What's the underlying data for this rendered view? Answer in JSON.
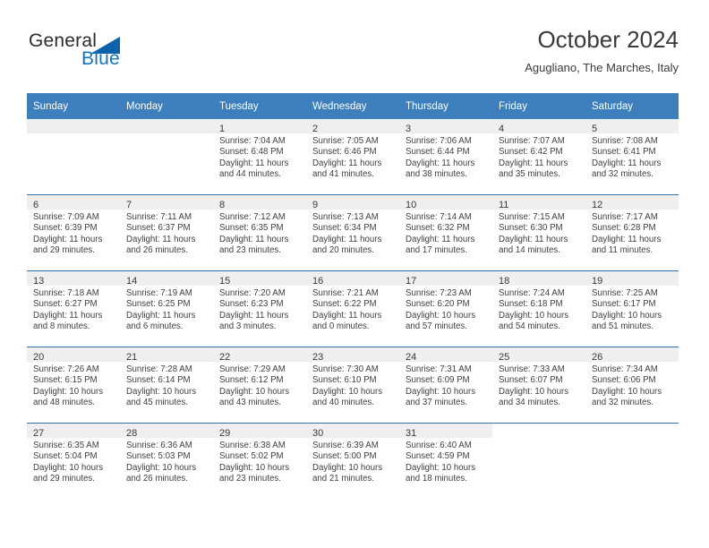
{
  "brand": {
    "name_part1": "General",
    "name_part2": "Blue",
    "accent_color": "#1275bc",
    "triangle_color": "#0b62a8"
  },
  "header": {
    "title": "October 2024",
    "subtitle": "Agugliano, The Marches, Italy"
  },
  "theme": {
    "header_row_bg": "#3d7ebd",
    "row_separator": "#2f6fad",
    "daynum_band_bg": "#efefef",
    "text_color": "#3f3f3f"
  },
  "weekday_headers": [
    "Sunday",
    "Monday",
    "Tuesday",
    "Wednesday",
    "Thursday",
    "Friday",
    "Saturday"
  ],
  "labels": {
    "sunrise_prefix": "Sunrise:",
    "sunset_prefix": "Sunset:",
    "daylight_prefix": "Daylight:"
  },
  "weeks": [
    [
      {
        "day": "",
        "sunrise": "",
        "sunset": "",
        "daylight_line1": "",
        "daylight_line2": ""
      },
      {
        "day": "",
        "sunrise": "",
        "sunset": "",
        "daylight_line1": "",
        "daylight_line2": ""
      },
      {
        "day": "1",
        "sunrise": "Sunrise: 7:04 AM",
        "sunset": "Sunset: 6:48 PM",
        "daylight_line1": "Daylight: 11 hours",
        "daylight_line2": "and 44 minutes."
      },
      {
        "day": "2",
        "sunrise": "Sunrise: 7:05 AM",
        "sunset": "Sunset: 6:46 PM",
        "daylight_line1": "Daylight: 11 hours",
        "daylight_line2": "and 41 minutes."
      },
      {
        "day": "3",
        "sunrise": "Sunrise: 7:06 AM",
        "sunset": "Sunset: 6:44 PM",
        "daylight_line1": "Daylight: 11 hours",
        "daylight_line2": "and 38 minutes."
      },
      {
        "day": "4",
        "sunrise": "Sunrise: 7:07 AM",
        "sunset": "Sunset: 6:42 PM",
        "daylight_line1": "Daylight: 11 hours",
        "daylight_line2": "and 35 minutes."
      },
      {
        "day": "5",
        "sunrise": "Sunrise: 7:08 AM",
        "sunset": "Sunset: 6:41 PM",
        "daylight_line1": "Daylight: 11 hours",
        "daylight_line2": "and 32 minutes."
      }
    ],
    [
      {
        "day": "6",
        "sunrise": "Sunrise: 7:09 AM",
        "sunset": "Sunset: 6:39 PM",
        "daylight_line1": "Daylight: 11 hours",
        "daylight_line2": "and 29 minutes."
      },
      {
        "day": "7",
        "sunrise": "Sunrise: 7:11 AM",
        "sunset": "Sunset: 6:37 PM",
        "daylight_line1": "Daylight: 11 hours",
        "daylight_line2": "and 26 minutes."
      },
      {
        "day": "8",
        "sunrise": "Sunrise: 7:12 AM",
        "sunset": "Sunset: 6:35 PM",
        "daylight_line1": "Daylight: 11 hours",
        "daylight_line2": "and 23 minutes."
      },
      {
        "day": "9",
        "sunrise": "Sunrise: 7:13 AM",
        "sunset": "Sunset: 6:34 PM",
        "daylight_line1": "Daylight: 11 hours",
        "daylight_line2": "and 20 minutes."
      },
      {
        "day": "10",
        "sunrise": "Sunrise: 7:14 AM",
        "sunset": "Sunset: 6:32 PM",
        "daylight_line1": "Daylight: 11 hours",
        "daylight_line2": "and 17 minutes."
      },
      {
        "day": "11",
        "sunrise": "Sunrise: 7:15 AM",
        "sunset": "Sunset: 6:30 PM",
        "daylight_line1": "Daylight: 11 hours",
        "daylight_line2": "and 14 minutes."
      },
      {
        "day": "12",
        "sunrise": "Sunrise: 7:17 AM",
        "sunset": "Sunset: 6:28 PM",
        "daylight_line1": "Daylight: 11 hours",
        "daylight_line2": "and 11 minutes."
      }
    ],
    [
      {
        "day": "13",
        "sunrise": "Sunrise: 7:18 AM",
        "sunset": "Sunset: 6:27 PM",
        "daylight_line1": "Daylight: 11 hours",
        "daylight_line2": "and 8 minutes."
      },
      {
        "day": "14",
        "sunrise": "Sunrise: 7:19 AM",
        "sunset": "Sunset: 6:25 PM",
        "daylight_line1": "Daylight: 11 hours",
        "daylight_line2": "and 6 minutes."
      },
      {
        "day": "15",
        "sunrise": "Sunrise: 7:20 AM",
        "sunset": "Sunset: 6:23 PM",
        "daylight_line1": "Daylight: 11 hours",
        "daylight_line2": "and 3 minutes."
      },
      {
        "day": "16",
        "sunrise": "Sunrise: 7:21 AM",
        "sunset": "Sunset: 6:22 PM",
        "daylight_line1": "Daylight: 11 hours",
        "daylight_line2": "and 0 minutes."
      },
      {
        "day": "17",
        "sunrise": "Sunrise: 7:23 AM",
        "sunset": "Sunset: 6:20 PM",
        "daylight_line1": "Daylight: 10 hours",
        "daylight_line2": "and 57 minutes."
      },
      {
        "day": "18",
        "sunrise": "Sunrise: 7:24 AM",
        "sunset": "Sunset: 6:18 PM",
        "daylight_line1": "Daylight: 10 hours",
        "daylight_line2": "and 54 minutes."
      },
      {
        "day": "19",
        "sunrise": "Sunrise: 7:25 AM",
        "sunset": "Sunset: 6:17 PM",
        "daylight_line1": "Daylight: 10 hours",
        "daylight_line2": "and 51 minutes."
      }
    ],
    [
      {
        "day": "20",
        "sunrise": "Sunrise: 7:26 AM",
        "sunset": "Sunset: 6:15 PM",
        "daylight_line1": "Daylight: 10 hours",
        "daylight_line2": "and 48 minutes."
      },
      {
        "day": "21",
        "sunrise": "Sunrise: 7:28 AM",
        "sunset": "Sunset: 6:14 PM",
        "daylight_line1": "Daylight: 10 hours",
        "daylight_line2": "and 45 minutes."
      },
      {
        "day": "22",
        "sunrise": "Sunrise: 7:29 AM",
        "sunset": "Sunset: 6:12 PM",
        "daylight_line1": "Daylight: 10 hours",
        "daylight_line2": "and 43 minutes."
      },
      {
        "day": "23",
        "sunrise": "Sunrise: 7:30 AM",
        "sunset": "Sunset: 6:10 PM",
        "daylight_line1": "Daylight: 10 hours",
        "daylight_line2": "and 40 minutes."
      },
      {
        "day": "24",
        "sunrise": "Sunrise: 7:31 AM",
        "sunset": "Sunset: 6:09 PM",
        "daylight_line1": "Daylight: 10 hours",
        "daylight_line2": "and 37 minutes."
      },
      {
        "day": "25",
        "sunrise": "Sunrise: 7:33 AM",
        "sunset": "Sunset: 6:07 PM",
        "daylight_line1": "Daylight: 10 hours",
        "daylight_line2": "and 34 minutes."
      },
      {
        "day": "26",
        "sunrise": "Sunrise: 7:34 AM",
        "sunset": "Sunset: 6:06 PM",
        "daylight_line1": "Daylight: 10 hours",
        "daylight_line2": "and 32 minutes."
      }
    ],
    [
      {
        "day": "27",
        "sunrise": "Sunrise: 6:35 AM",
        "sunset": "Sunset: 5:04 PM",
        "daylight_line1": "Daylight: 10 hours",
        "daylight_line2": "and 29 minutes."
      },
      {
        "day": "28",
        "sunrise": "Sunrise: 6:36 AM",
        "sunset": "Sunset: 5:03 PM",
        "daylight_line1": "Daylight: 10 hours",
        "daylight_line2": "and 26 minutes."
      },
      {
        "day": "29",
        "sunrise": "Sunrise: 6:38 AM",
        "sunset": "Sunset: 5:02 PM",
        "daylight_line1": "Daylight: 10 hours",
        "daylight_line2": "and 23 minutes."
      },
      {
        "day": "30",
        "sunrise": "Sunrise: 6:39 AM",
        "sunset": "Sunset: 5:00 PM",
        "daylight_line1": "Daylight: 10 hours",
        "daylight_line2": "and 21 minutes."
      },
      {
        "day": "31",
        "sunrise": "Sunrise: 6:40 AM",
        "sunset": "Sunset: 4:59 PM",
        "daylight_line1": "Daylight: 10 hours",
        "daylight_line2": "and 18 minutes."
      },
      {
        "day": "",
        "sunrise": "",
        "sunset": "",
        "daylight_line1": "",
        "daylight_line2": ""
      },
      {
        "day": "",
        "sunrise": "",
        "sunset": "",
        "daylight_line1": "",
        "daylight_line2": ""
      }
    ]
  ]
}
